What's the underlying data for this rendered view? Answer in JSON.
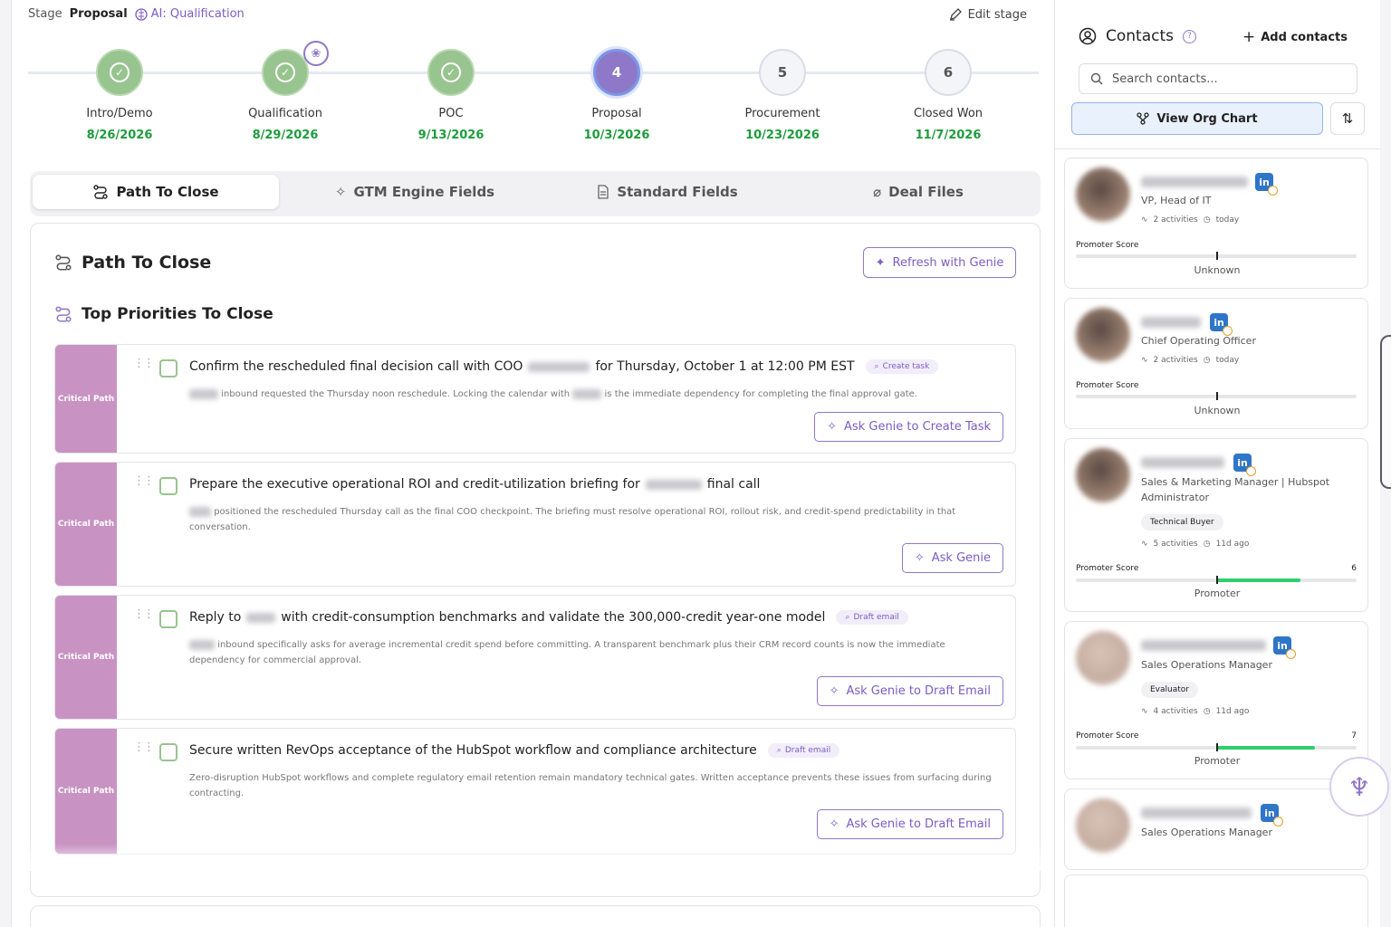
{
  "stage": {
    "label": "Stage",
    "value": "Proposal",
    "ai": "AI: Qualification"
  },
  "edit_stage": "Edit stage",
  "steps": [
    {
      "status": "done",
      "name": "Intro/Demo",
      "date": "8/26/2026"
    },
    {
      "status": "done",
      "name": "Qualification",
      "date": "8/29/2026",
      "ai": true
    },
    {
      "status": "done",
      "name": "POC",
      "date": "9/13/2026"
    },
    {
      "status": "current",
      "num": "4",
      "name": "Proposal",
      "date": "10/3/2026"
    },
    {
      "status": "future",
      "num": "5",
      "name": "Procurement",
      "date": "10/23/2026"
    },
    {
      "status": "future",
      "num": "6",
      "name": "Closed Won",
      "date": "11/7/2026"
    }
  ],
  "tabs": [
    "Path To Close",
    "GTM Engine Fields",
    "Standard Fields",
    "Deal Files"
  ],
  "card": {
    "title": "Path To Close",
    "refresh": "Refresh with Genie",
    "subtitle": "Top Priorities To Close"
  },
  "tasks": [
    {
      "strip": "Critical Path",
      "title_a": "Confirm the rescheduled final decision call with COO",
      "title_b": "for Thursday, October 1 at 12:00 PM EST",
      "chip": "Create task",
      "desc_a": "inbound requested the Thursday noon reschedule. Locking the calendar with",
      "desc_b": "is the immediate dependency for completing the final approval gate.",
      "button": "Ask Genie to Create Task"
    },
    {
      "strip": "Critical Path",
      "title_a": "Prepare the executive operational ROI and credit-utilization briefing for",
      "title_b": "final call",
      "desc_a": "positioned the rescheduled Thursday call as the final COO checkpoint. The briefing must resolve operational ROI, rollout risk, and credit-spend predictability in that conversation.",
      "button": "Ask Genie"
    },
    {
      "strip": "Critical Path",
      "title_a": "Reply to",
      "title_b": "with credit-consumption benchmarks and validate the 300,000-credit year-one model",
      "chip": "Draft email",
      "desc_a": "inbound specifically asks for average incremental credit spend before committing. A transparent benchmark plus their CRM record counts is now the immediate dependency for commercial approval.",
      "button": "Ask Genie to Draft Email"
    },
    {
      "strip": "Critical Path",
      "title_a": "Secure written RevOps acceptance of the HubSpot workflow and compliance architecture",
      "chip": "Draft email",
      "desc_a": "Zero-disruption HubSpot workflows and complete regulatory email retention remain mandatory technical gates. Written acceptance prevents these issues from surfacing during contracting.",
      "button": "Ask Genie to Draft Email"
    }
  ],
  "contacts_panel": {
    "title": "Contacts",
    "add": "Add contacts",
    "search_placeholder": "Search contacts...",
    "org_chart": "View Org Chart",
    "promoter_label": "Promoter Score"
  },
  "contacts": [
    {
      "role": "VP, Head of IT",
      "activities": "2 activities",
      "when": "today",
      "score": "",
      "score_fraction": 0,
      "caption": "Unknown"
    },
    {
      "role": "Chief Operating Officer",
      "activities": "2 activities",
      "when": "today",
      "score": "",
      "score_fraction": 0,
      "caption": "Unknown"
    },
    {
      "role": "Sales & Marketing Manager | Hubspot Administrator",
      "tag": "Technical Buyer",
      "activities": "5 activities",
      "when": "11d ago",
      "score": "6",
      "score_fraction": 0.6,
      "caption": "Promoter"
    },
    {
      "role": "Sales Operations Manager",
      "tag": "Evaluator",
      "activities": "4 activities",
      "when": "11d ago",
      "score": "7",
      "score_fraction": 0.7,
      "caption": "Promoter"
    },
    {
      "role": "Sales Operations Manager"
    }
  ],
  "colors": {
    "accent": "#7c5cc4",
    "success": "#1e9c3c",
    "strip": "#c893c3",
    "done": "#98c48f"
  }
}
